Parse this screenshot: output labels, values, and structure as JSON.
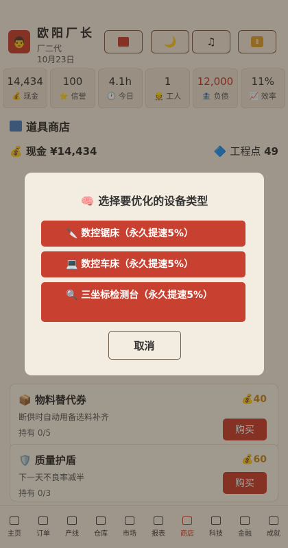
{
  "header": {
    "player_name": "欧阳厂长",
    "generation": "厂二代",
    "date": "10月23日",
    "avatar_glyph": "👨",
    "button_icons": [
      "ledger-icon",
      "moon-icon",
      "music-icon",
      "pause-icon"
    ],
    "button_glyphs": [
      "",
      "🌙",
      "♫",
      "Ⅱ"
    ]
  },
  "stats": [
    {
      "value": "14,434",
      "label": "💰 现金"
    },
    {
      "value": "100",
      "label": "⭐ 信誉"
    },
    {
      "value": "4.1h",
      "label": "🕐 今日"
    },
    {
      "value": "1",
      "label": "👷 工人"
    },
    {
      "value": "12,000",
      "label": "🏦 负债"
    },
    {
      "value": "11%",
      "label": "📈 效率"
    }
  ],
  "shop": {
    "title": "道具商店",
    "cash_label": "💰 现金 ¥14,434",
    "engineering_label": "🔷 工程点",
    "engineering_value": "49"
  },
  "cards": [
    {
      "name": "📦 物料替代券",
      "desc": "断供时自动用备选料补齐",
      "hold": "持有 0/5",
      "price": "💰40",
      "buy": "购买"
    },
    {
      "name": "🛡️ 质量护盾",
      "desc": "下一天不良率减半",
      "hold": "持有 0/3",
      "price": "💰60",
      "buy": "购买"
    }
  ],
  "tabs": [
    "主页",
    "订单",
    "产线",
    "仓库",
    "市场",
    "报表",
    "商店",
    "科技",
    "金融",
    "成就"
  ],
  "active_tab": "商店",
  "modal": {
    "title": "🧠 选择要优化的设备类型",
    "options": [
      "🔪 数控锯床（永久提速5%）",
      "💻 数控车床（永久提速5%）",
      "🔍 三坐标检测台（永久提速5%）"
    ],
    "cancel": "取消"
  },
  "colors": {
    "accent": "#c8402f",
    "background": "#f3ece0",
    "debt": "#c23a2a",
    "price": "#c48a1a"
  }
}
